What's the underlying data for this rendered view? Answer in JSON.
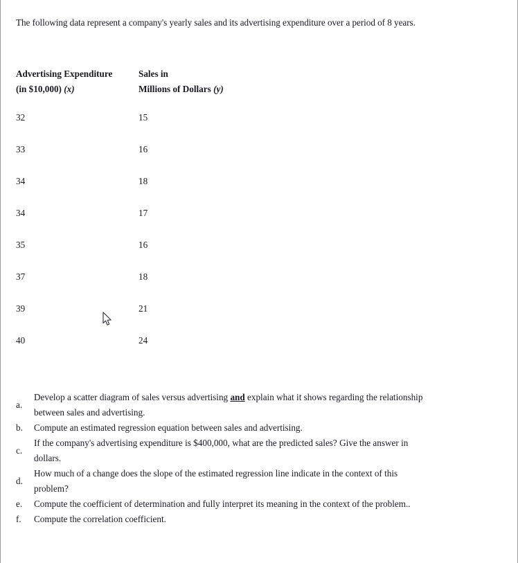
{
  "document": {
    "intro": "The following data represent a company's yearly sales and its advertising expenditure over a period of 8 years."
  },
  "table": {
    "headers": {
      "x_line1": "Advertising Expenditure",
      "x_line2_prefix": "(in $10,000) ",
      "x_line2_var": "(x)",
      "y_line1": "Sales in",
      "y_line2_prefix": "Millions of Dollars ",
      "y_line2_var": "(y)"
    },
    "rows": [
      {
        "x": "32",
        "y": "15"
      },
      {
        "x": "33",
        "y": "16"
      },
      {
        "x": "34",
        "y": "18"
      },
      {
        "x": "34",
        "y": "17"
      },
      {
        "x": "35",
        "y": "16"
      },
      {
        "x": "37",
        "y": "18"
      },
      {
        "x": "39",
        "y": "21"
      },
      {
        "x": "40",
        "y": "24"
      }
    ]
  },
  "chart_data": {
    "type": "table",
    "title": "Yearly sales and advertising expenditure over 8 years",
    "xlabel": "Advertising Expenditure (in $10,000) (x)",
    "ylabel": "Sales in Millions of Dollars (y)",
    "categories": [
      "32",
      "33",
      "34",
      "34",
      "35",
      "37",
      "39",
      "40"
    ],
    "x": [
      32,
      33,
      34,
      34,
      35,
      37,
      39,
      40
    ],
    "series": [
      {
        "name": "Sales in Millions of Dollars (y)",
        "values": [
          15,
          16,
          18,
          17,
          16,
          18,
          21,
          24
        ]
      }
    ],
    "columns": [
      "Advertising Expenditure (in $10,000) (x)",
      "Sales in Millions of Dollars (y)"
    ],
    "values": [
      [
        32,
        15
      ],
      [
        33,
        16
      ],
      [
        34,
        18
      ],
      [
        34,
        17
      ],
      [
        35,
        16
      ],
      [
        37,
        18
      ],
      [
        39,
        21
      ],
      [
        40,
        24
      ]
    ],
    "n": 8
  },
  "questions": [
    {
      "marker": "a.",
      "text_before": "Develop a scatter diagram of sales versus advertising ",
      "emphasis": "and",
      "text_after": " explain what it shows regarding the relationship between sales and advertising."
    },
    {
      "marker": "b.",
      "text_before": "Compute an estimated regression equation between sales and advertising.",
      "emphasis": "",
      "text_after": ""
    },
    {
      "marker": "c.",
      "text_before": "If the company's advertising expenditure is $400,000, what are the predicted sales? Give the answer in dollars.",
      "emphasis": "",
      "text_after": ""
    },
    {
      "marker": "d.",
      "text_before": "How much of a change does the slope of the estimated regression line indicate in the context of this problem?",
      "emphasis": "",
      "text_after": ""
    },
    {
      "marker": "e.",
      "text_before": "Compute the coefficient of determination and fully interpret its meaning in the context of the problem..",
      "emphasis": "",
      "text_after": ""
    },
    {
      "marker": "f.",
      "text_before": "Compute the correlation coefficient.",
      "emphasis": "",
      "text_after": ""
    }
  ],
  "pointer": {
    "icon": "arrow-cursor-icon"
  },
  "colors": {
    "text": "#1a1a22",
    "page_background": "#ffffff",
    "page_rule": "#9a9a9a"
  }
}
